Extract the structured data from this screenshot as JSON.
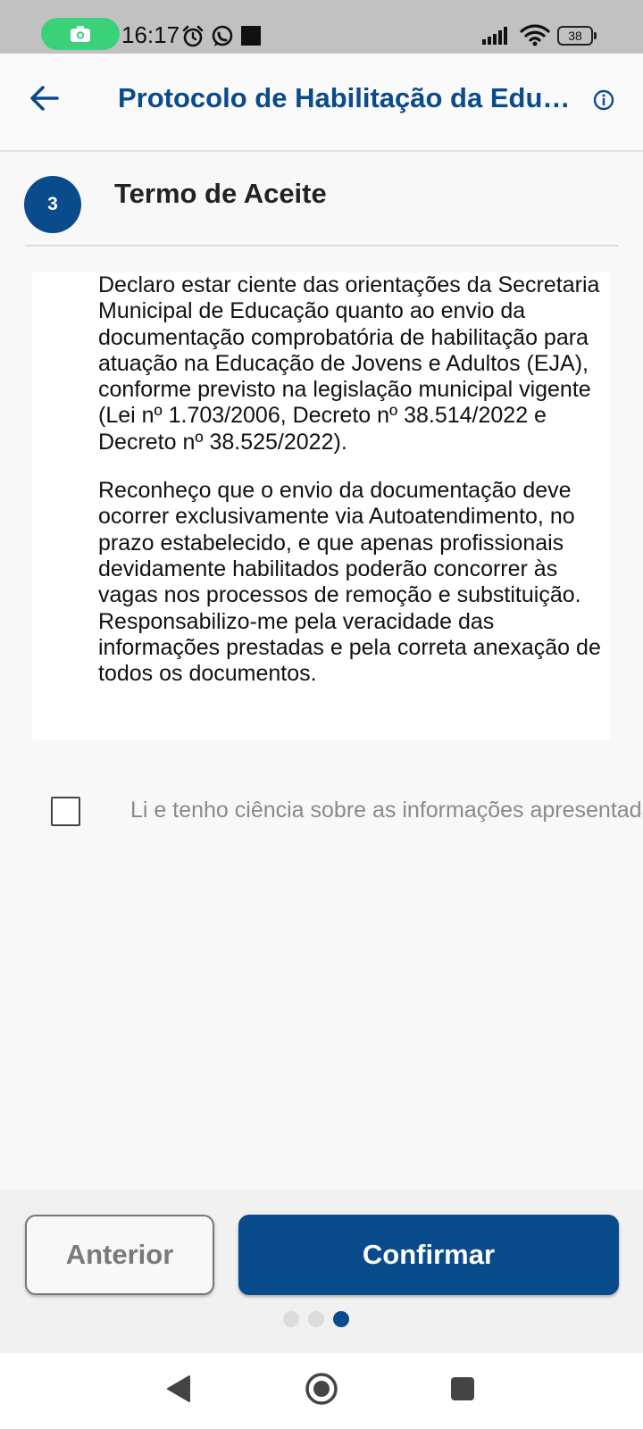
{
  "status_bar": {
    "time": "16:17",
    "battery": "38",
    "icons": [
      "camera-icon",
      "alarm-icon",
      "whatsapp-icon",
      "notification-square-icon",
      "signal-icon",
      "wifi-icon",
      "battery-icon"
    ]
  },
  "header": {
    "title": "Protocolo de Habilitação da Educação de Jovens e Adultos",
    "back_icon": "arrow-left-icon",
    "info_icon": "info-icon"
  },
  "step": {
    "number": "3",
    "title": "Termo de Aceite"
  },
  "terms": {
    "paragraph_1": "Declaro estar ciente das orientações da Secretaria Municipal de Educação quanto ao envio da documentação comprobatória de habilitação para atuação na Educação de Jovens e Adultos (EJA), conforme previsto na legislação municipal vigente (Lei nº 1.703/2006, Decreto nº 38.514/2022 e Decreto nº 38.525/2022).",
    "paragraph_2": "Reconheço que o envio da documentação deve ocorrer exclusivamente via Autoatendimento, no prazo estabelecido, e que apenas profissionais devidamente habilitados poderão concorrer às vagas nos processos de remoção e substituição. Responsabilizo-me pela veracidade das informações prestadas e pela correta anexação de todos os documentos."
  },
  "acknowledgement": {
    "label": "Li e tenho ciência sobre as informações apresentadas",
    "checked": false
  },
  "buttons": {
    "previous": "Anterior",
    "confirm": "Confirmar"
  },
  "pagination": {
    "total": 3,
    "active": 3
  },
  "colors": {
    "primary": "#0a4b8c",
    "status_bar": "#c1c1c1",
    "camera_pill": "#3bd17a",
    "muted_text": "#8a8a8a"
  },
  "nav_bar": {
    "icons": [
      "back-triangle-icon",
      "home-circle-icon",
      "recents-square-icon"
    ]
  }
}
